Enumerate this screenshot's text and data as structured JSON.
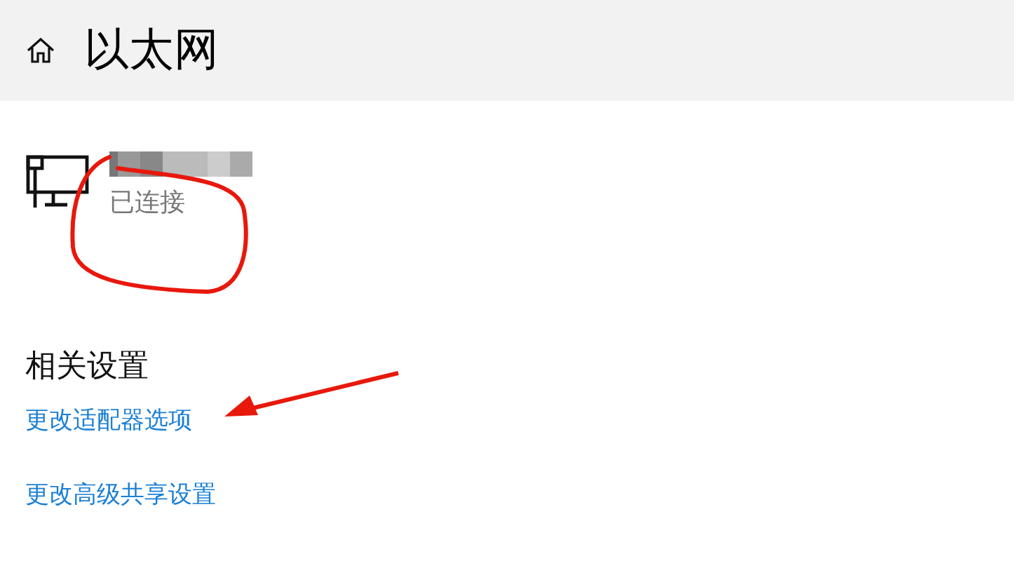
{
  "page": {
    "title": "以太网"
  },
  "connection": {
    "status": "已连接"
  },
  "related_settings": {
    "heading": "相关设置",
    "links": [
      "更改适配器选项",
      "更改高级共享设置"
    ]
  }
}
